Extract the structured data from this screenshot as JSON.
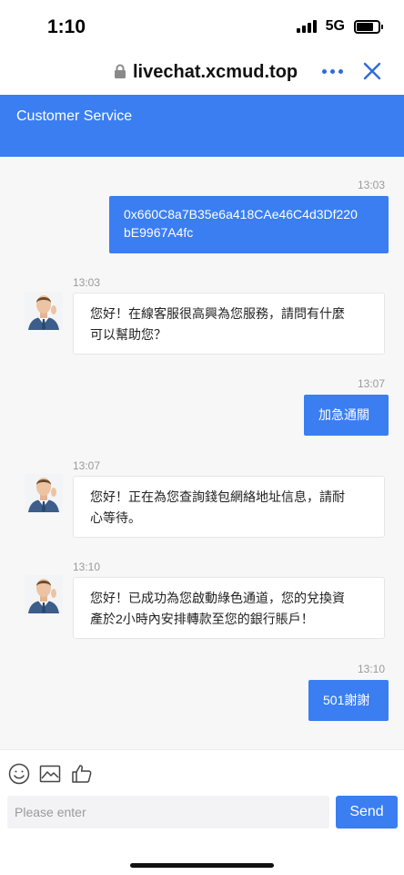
{
  "status_bar": {
    "time": "1:10",
    "network": "5G"
  },
  "browser": {
    "url": "livechat.xcmud.top"
  },
  "header": {
    "title": "Customer Service"
  },
  "messages": [
    {
      "time": "13:03",
      "text": "0x660C8a7B35e6a418CAe46C4d3Df220\nbE9967A4fc"
    },
    {
      "time": "13:03",
      "text": "您好！在線客服很高興為您服務，請問有什麼\n可以幫助您？"
    },
    {
      "time": "13:07",
      "text": "加急通關"
    },
    {
      "time": "13:07",
      "text": "您好！正在為您查詢錢包網絡地址信息，請耐\n心等待。"
    },
    {
      "time": "13:10",
      "text": "您好！已成功為您啟動綠色通道，您的兌換資\n產於2小時內安排轉款至您的銀行賬戶！"
    },
    {
      "time": "13:10",
      "text": "501謝謝"
    }
  ],
  "composer": {
    "placeholder": "Please enter",
    "send_label": "Send"
  },
  "colors": {
    "accent": "#3a7ef2",
    "background": "#f7f7f8"
  }
}
